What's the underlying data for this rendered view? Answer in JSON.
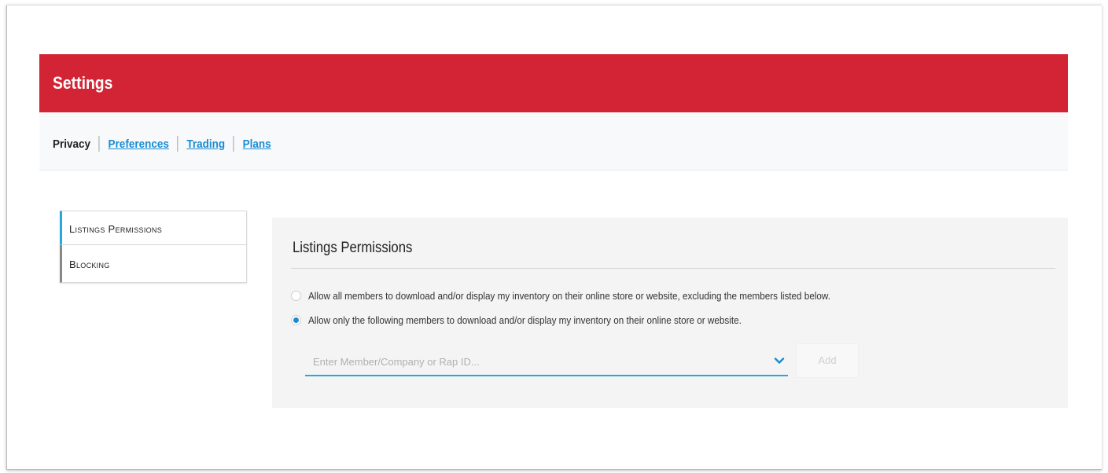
{
  "header": {
    "title": "Settings",
    "color": "#d22434"
  },
  "nav": {
    "items": [
      {
        "label": "Privacy",
        "active": true
      },
      {
        "label": "Preferences",
        "active": false
      },
      {
        "label": "Trading",
        "active": false
      },
      {
        "label": "Plans",
        "active": false
      }
    ]
  },
  "sidebar": {
    "items": [
      {
        "label": "Listings Permissions",
        "active": true
      },
      {
        "label": "Blocking",
        "active": false
      }
    ]
  },
  "panel": {
    "title": "Listings Permissions",
    "options": [
      {
        "label": "Allow all members to download and/or display my inventory on their online store or website, excluding the members listed below.",
        "checked": false
      },
      {
        "label": "Allow only the following members to download and/or display my inventory on their online store or website.",
        "checked": true
      }
    ],
    "member_input": {
      "placeholder": "Enter Member/Company or Rap ID...",
      "value": ""
    },
    "add_label": "Add"
  },
  "colors": {
    "accent": "#29a8e0",
    "link": "#1a8cd2",
    "brand": "#d22434"
  },
  "icons": {
    "dropdown": "chevron-down-icon"
  }
}
